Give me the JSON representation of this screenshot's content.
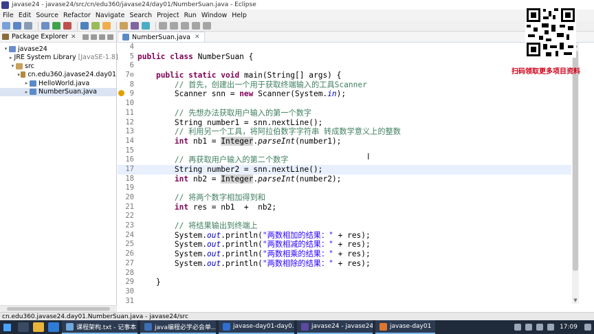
{
  "window": {
    "title": "javase24 - javase24/src/cn/edu360/javase24/day01/NumberSuan.java - Eclipse"
  },
  "menu": [
    "File",
    "Edit",
    "Source",
    "Refactor",
    "Navigate",
    "Search",
    "Project",
    "Run",
    "Window",
    "Help"
  ],
  "promo_text": "扫码领取更多项目资料",
  "package_explorer": {
    "title": "Package Explorer",
    "close": "✕",
    "tree": [
      {
        "label": "javase24",
        "twisty": "▾",
        "icon_color": "#6b8ec9"
      },
      {
        "label": "JRE System Library",
        "suffix": "[JavaSE-1.8]",
        "twisty": "▸",
        "icon_color": "#8a6d3b"
      },
      {
        "label": "src",
        "twisty": "▾",
        "icon_color": "#c9a15a"
      },
      {
        "label": "cn.edu360.javase24.day01",
        "twisty": "▾",
        "icon_color": "#b48a3c"
      },
      {
        "label": "HelloWorld.java",
        "twisty": "▸",
        "icon_color": "#5a8bc7"
      },
      {
        "label": "NumberSuan.java",
        "twisty": "▸",
        "icon_color": "#5a8bc7",
        "selected": true
      }
    ]
  },
  "editor": {
    "tab_label": "NumberSuan.java",
    "tab_close": "✕",
    "lines": [
      {
        "no": "4",
        "parts": []
      },
      {
        "no": "5",
        "parts": [
          [
            "kw",
            "public class "
          ],
          [
            "",
            "NumberSuan {"
          ]
        ]
      },
      {
        "no": "6",
        "parts": []
      },
      {
        "no": "7⊖",
        "parts": [
          [
            "",
            "    "
          ],
          [
            "kw",
            "public static void "
          ],
          [
            "",
            "main(String[] args) {"
          ]
        ]
      },
      {
        "no": "8",
        "parts": [
          [
            "",
            "        "
          ],
          [
            "cm",
            "// 首先，创建出一个用于获取终端输入的工具Scanner"
          ]
        ]
      },
      {
        "no": "9",
        "marker": true,
        "parts": [
          [
            "",
            "        Scanner snn = "
          ],
          [
            "kw",
            "new "
          ],
          [
            "",
            "Scanner(System."
          ],
          [
            "fld",
            "in"
          ],
          [
            "",
            ");"
          ]
        ]
      },
      {
        "no": "10",
        "parts": []
      },
      {
        "no": "11",
        "parts": [
          [
            "",
            "        "
          ],
          [
            "cm",
            "// 先想办法获取用户输入的第一个数字"
          ]
        ]
      },
      {
        "no": "12",
        "parts": [
          [
            "",
            "        String number1 = snn.nextLine();"
          ]
        ]
      },
      {
        "no": "13",
        "parts": [
          [
            "",
            "        "
          ],
          [
            "cm",
            "// 利用另一个工具，将阿拉伯数字字符串 转成数学意义上的整数"
          ]
        ]
      },
      {
        "no": "14",
        "parts": [
          [
            "",
            "        "
          ],
          [
            "kw",
            "int "
          ],
          [
            "",
            "nb1 = "
          ],
          [
            "hl",
            "Integer"
          ],
          [
            "",
            "."
          ],
          [
            "it",
            "parseInt"
          ],
          [
            "",
            "(number1);"
          ]
        ]
      },
      {
        "no": "15",
        "parts": []
      },
      {
        "no": "16",
        "parts": [
          [
            "",
            "        "
          ],
          [
            "cm",
            "// 再获取用户输入的第二个数字"
          ]
        ]
      },
      {
        "no": "17",
        "current": true,
        "parts": [
          [
            "",
            "        String number2 = snn.nextLine();"
          ]
        ]
      },
      {
        "no": "18",
        "parts": [
          [
            "",
            "        "
          ],
          [
            "kw",
            "int "
          ],
          [
            "",
            "nb2 = "
          ],
          [
            "hl",
            "Integer"
          ],
          [
            "",
            "."
          ],
          [
            "it",
            "parseInt"
          ],
          [
            "",
            "(number2);"
          ]
        ]
      },
      {
        "no": "19",
        "parts": []
      },
      {
        "no": "20",
        "parts": [
          [
            "",
            "        "
          ],
          [
            "cm",
            "// 将两个数字相加得到和"
          ]
        ]
      },
      {
        "no": "21",
        "parts": [
          [
            "",
            "        "
          ],
          [
            "kw",
            "int "
          ],
          [
            "",
            "res = nb1  +  nb2;"
          ]
        ]
      },
      {
        "no": "22",
        "parts": []
      },
      {
        "no": "23",
        "parts": [
          [
            "",
            "        "
          ],
          [
            "cm",
            "// 将结果输出到终端上"
          ]
        ]
      },
      {
        "no": "24",
        "parts": [
          [
            "",
            "        System."
          ],
          [
            "fld",
            "out"
          ],
          [
            "",
            ".println("
          ],
          [
            "str",
            "\"两数相加的结果：\""
          ],
          [
            "",
            " + res);"
          ]
        ]
      },
      {
        "no": "25",
        "parts": [
          [
            "",
            "        System."
          ],
          [
            "fld",
            "out"
          ],
          [
            "",
            ".println("
          ],
          [
            "str",
            "\"两数相减的结果：\""
          ],
          [
            "",
            " + res);"
          ]
        ]
      },
      {
        "no": "26",
        "parts": [
          [
            "",
            "        System."
          ],
          [
            "fld",
            "out"
          ],
          [
            "",
            ".println("
          ],
          [
            "str",
            "\"两数相乘的结果：\""
          ],
          [
            "",
            " + res);"
          ]
        ]
      },
      {
        "no": "27",
        "parts": [
          [
            "",
            "        System."
          ],
          [
            "fld",
            "out"
          ],
          [
            "",
            ".println("
          ],
          [
            "str",
            "\"两数相除的结果：\""
          ],
          [
            "",
            " + res);"
          ]
        ]
      },
      {
        "no": "28",
        "parts": []
      },
      {
        "no": "29",
        "parts": [
          [
            "",
            "    }"
          ]
        ]
      },
      {
        "no": "30",
        "parts": []
      },
      {
        "no": "31",
        "parts": []
      }
    ]
  },
  "cursor_glyph": "I",
  "status_bar": {
    "text": "cn.edu360.javase24.day01.NumberSuan.java - javase24/src"
  },
  "taskbar": {
    "tasks": [
      {
        "label": "课程架构.txt - 记事本",
        "color": "#6fa8dc"
      },
      {
        "label": "java编程必学必会单...",
        "color": "#3d6fb5"
      },
      {
        "label": "javase-day01-day0...",
        "color": "#2e6fd1"
      },
      {
        "label": "javase24 - javase24...",
        "color": "#5b4aa0"
      },
      {
        "label": "javase-day01",
        "color": "#e0762c"
      }
    ],
    "clock": "17:09"
  }
}
